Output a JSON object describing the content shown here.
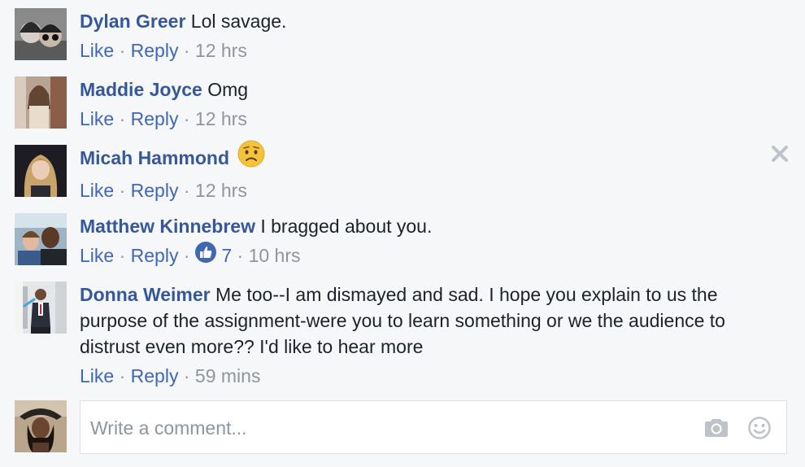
{
  "comments": [
    {
      "name": "Dylan Greer",
      "text": "Lol savage.",
      "like": "Like",
      "reply": "Reply",
      "time": "12 hrs"
    },
    {
      "name": "Maddie Joyce",
      "text": "Omg",
      "like": "Like",
      "reply": "Reply",
      "time": "12 hrs"
    },
    {
      "name": "Micah Hammond",
      "text": "",
      "like": "Like",
      "reply": "Reply",
      "time": "12 hrs"
    },
    {
      "name": "Matthew Kinnebrew",
      "text": "I bragged about you.",
      "like": "Like",
      "reply": "Reply",
      "likes": "7",
      "time": "10 hrs"
    },
    {
      "name": "Donna Weimer",
      "text": "Me too--I am dismayed and sad. I hope you explain to us the purpose of the assignment-were you to learn something or we the audience to distrust even more?? I'd like to hear more",
      "like": "Like",
      "reply": "Reply",
      "time": "59 mins"
    }
  ],
  "composer": {
    "placeholder": "Write a comment..."
  },
  "separator": "·",
  "icons": {
    "reaction": "worried-face-emoji-icon",
    "remove": "close-icon",
    "likes_badge": "thumbs-up-icon",
    "camera": "camera-icon",
    "emoji": "smiley-icon"
  },
  "colors": {
    "name": "#365899",
    "link": "#4267b2",
    "muted": "#90949c",
    "like_badge": "#4267b2"
  }
}
